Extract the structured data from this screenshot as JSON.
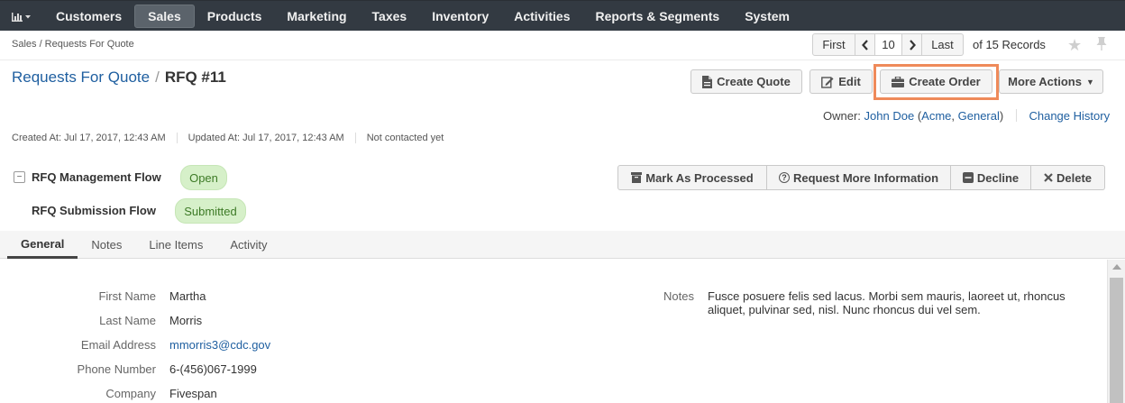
{
  "nav": {
    "dashboard_icon": "bar-chart-icon",
    "items": [
      "Customers",
      "Sales",
      "Products",
      "Marketing",
      "Taxes",
      "Inventory",
      "Activities",
      "Reports & Segments",
      "System"
    ],
    "active": "Sales"
  },
  "breadcrumb": "Sales / Requests For Quote",
  "pager": {
    "first": "First",
    "page": "10",
    "last": "Last",
    "total": "of 15 Records"
  },
  "title": {
    "parent": "Requests For Quote",
    "separator": "/",
    "current": "RFQ #11"
  },
  "actions": {
    "create_quote": "Create Quote",
    "edit": "Edit",
    "create_order": "Create Order",
    "more_actions": "More Actions"
  },
  "owner": {
    "label": "Owner:",
    "name": "John Doe",
    "org_open": "(",
    "org1": "Acme",
    "org_sep": ", ",
    "org2": "General",
    "org_close": ")",
    "change_history": "Change History"
  },
  "meta": {
    "created": "Created At: Jul 17, 2017, 12:43 AM",
    "updated": "Updated At: Jul 17, 2017, 12:43 AM",
    "contacted": "Not contacted yet"
  },
  "workflow": {
    "management_label": "RFQ Management Flow",
    "management_status": "Open",
    "submission_label": "RFQ Submission Flow",
    "submission_status": "Submitted",
    "buttons": [
      "Mark As Processed",
      "Request More Information",
      "Decline",
      "Delete"
    ]
  },
  "tabs": [
    "General",
    "Notes",
    "Line Items",
    "Activity"
  ],
  "fields": {
    "first_name_label": "First Name",
    "first_name": "Martha",
    "last_name_label": "Last Name",
    "last_name": "Morris",
    "email_label": "Email Address",
    "email": "mmorris3@cdc.gov",
    "phone_label": "Phone Number",
    "phone": "6-(456)067-1999",
    "company_label": "Company",
    "company": "Fivespan",
    "notes_label": "Notes",
    "notes": "Fusce posuere felis sed lacus. Morbi sem mauris, laoreet ut, rhoncus aliquet, pulvinar sed, nisl. Nunc rhoncus dui vel sem."
  },
  "colors": {
    "nav_bg": "#333a42",
    "highlight": "#ef8a5a",
    "status_bg": "#d6f0c9",
    "link": "#1f5fa0"
  }
}
